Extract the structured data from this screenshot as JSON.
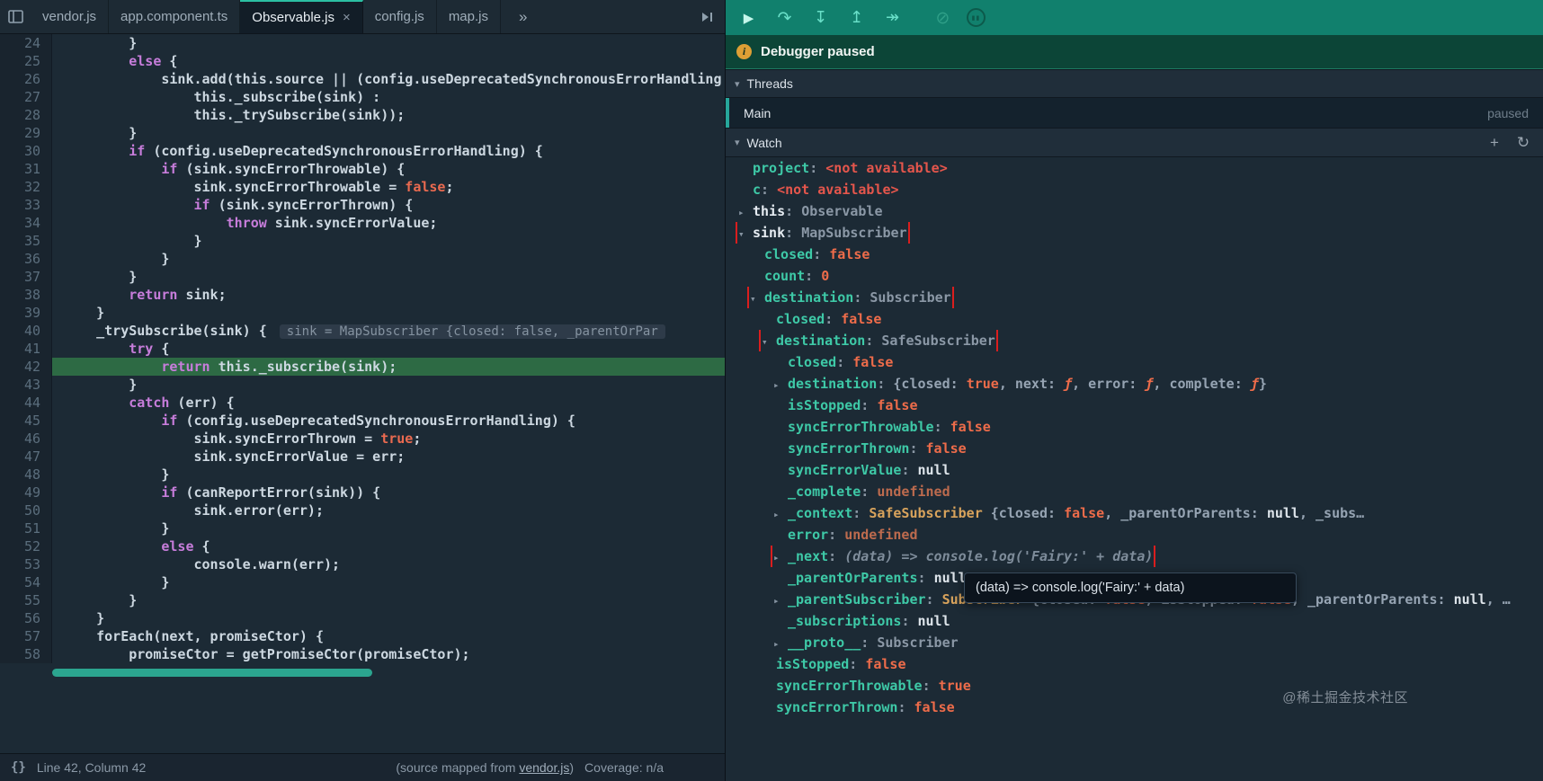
{
  "tabbar": {
    "tabs": [
      {
        "label": "vendor.js",
        "active": false
      },
      {
        "label": "app.component.ts",
        "active": false
      },
      {
        "label": "Observable.js",
        "active": true,
        "close_label": "×"
      },
      {
        "label": "config.js",
        "active": false
      },
      {
        "label": "map.js",
        "active": false
      }
    ],
    "overflow_label": "»"
  },
  "editor": {
    "current_line": 42,
    "inline_preview": {
      "line": 40,
      "text": "sink = MapSubscriber {closed: false, _parentOrPar"
    },
    "lines": [
      {
        "n": 24,
        "t": "        }"
      },
      {
        "n": 25,
        "t": "        else {"
      },
      {
        "n": 26,
        "t": "            sink.add(this.source || (config.useDeprecatedSynchronousErrorHandling ?"
      },
      {
        "n": 27,
        "t": "                this._subscribe(sink) :"
      },
      {
        "n": 28,
        "t": "                this._trySubscribe(sink));"
      },
      {
        "n": 29,
        "t": "        }"
      },
      {
        "n": 30,
        "t": "        if (config.useDeprecatedSynchronousErrorHandling) {"
      },
      {
        "n": 31,
        "t": "            if (sink.syncErrorThrowable) {"
      },
      {
        "n": 32,
        "t": "                sink.syncErrorThrowable = false;"
      },
      {
        "n": 33,
        "t": "                if (sink.syncErrorThrown) {"
      },
      {
        "n": 34,
        "t": "                    throw sink.syncErrorValue;"
      },
      {
        "n": 35,
        "t": "                }"
      },
      {
        "n": 36,
        "t": "            }"
      },
      {
        "n": 37,
        "t": "        }"
      },
      {
        "n": 38,
        "t": "        return sink;"
      },
      {
        "n": 39,
        "t": "    }"
      },
      {
        "n": 40,
        "t": "    _trySubscribe(sink) {"
      },
      {
        "n": 41,
        "t": "        try {"
      },
      {
        "n": 42,
        "t": "            return this._subscribe(sink);"
      },
      {
        "n": 43,
        "t": "        }"
      },
      {
        "n": 44,
        "t": "        catch (err) {"
      },
      {
        "n": 45,
        "t": "            if (config.useDeprecatedSynchronousErrorHandling) {"
      },
      {
        "n": 46,
        "t": "                sink.syncErrorThrown = true;"
      },
      {
        "n": 47,
        "t": "                sink.syncErrorValue = err;"
      },
      {
        "n": 48,
        "t": "            }"
      },
      {
        "n": 49,
        "t": "            if (canReportError(sink)) {"
      },
      {
        "n": 50,
        "t": "                sink.error(err);"
      },
      {
        "n": 51,
        "t": "            }"
      },
      {
        "n": 52,
        "t": "            else {"
      },
      {
        "n": 53,
        "t": "                console.warn(err);"
      },
      {
        "n": 54,
        "t": "            }"
      },
      {
        "n": 55,
        "t": "        }"
      },
      {
        "n": 56,
        "t": "    }"
      },
      {
        "n": 57,
        "t": "    forEach(next, promiseCtor) {"
      },
      {
        "n": 58,
        "t": "        promiseCtor = getPromiseCtor(promiseCtor);"
      }
    ]
  },
  "statusbar": {
    "brackets_icon": "{}",
    "cursor_position": "Line 42, Column 42",
    "source_map_prefix": "(source mapped from ",
    "source_map_link": "vendor.js",
    "source_map_suffix": ")",
    "coverage": "Coverage: n/a"
  },
  "debugger_panel": {
    "toolbar_icons": [
      {
        "name": "resume",
        "glyph": "▶"
      },
      {
        "name": "step-over",
        "glyph": "↷"
      },
      {
        "name": "step-in",
        "glyph": "↧"
      },
      {
        "name": "step-out",
        "glyph": "↥"
      },
      {
        "name": "step-forward",
        "glyph": "↠"
      },
      {
        "name": "deactivate-breakpoints",
        "glyph": "⊘"
      },
      {
        "name": "pause-on-exceptions",
        "glyph": "▮▮"
      }
    ],
    "paused_banner": {
      "text": "Debugger paused"
    },
    "threads": {
      "title": "Threads",
      "items": [
        {
          "name": "Main",
          "state": "paused"
        }
      ]
    },
    "watch": {
      "title": "Watch",
      "add_icon": "+",
      "refresh_icon": "↻",
      "rows": [
        {
          "indent": 0,
          "arrow": "none",
          "name": "project",
          "name_style": "green",
          "boxed": false,
          "value": [
            {
              "s": "err",
              "t": "<not available>"
            }
          ]
        },
        {
          "indent": 0,
          "arrow": "none",
          "name": "c",
          "name_style": "green",
          "boxed": false,
          "value": [
            {
              "s": "err",
              "t": "<not available>"
            }
          ]
        },
        {
          "indent": 0,
          "arrow": "collapsed",
          "name": "this",
          "name_style": "light",
          "boxed": false,
          "value": [
            {
              "s": "cls",
              "t": "Observable"
            }
          ]
        },
        {
          "indent": 0,
          "arrow": "expanded",
          "name": "sink",
          "name_style": "light",
          "boxed": true,
          "value": [
            {
              "s": "cls",
              "t": "MapSubscriber"
            }
          ]
        },
        {
          "indent": 1,
          "arrow": "none",
          "name": "closed",
          "name_style": "green",
          "boxed": false,
          "value": [
            {
              "s": "bool",
              "t": "false"
            }
          ]
        },
        {
          "indent": 1,
          "arrow": "none",
          "name": "count",
          "name_style": "green",
          "boxed": false,
          "value": [
            {
              "s": "num",
              "t": "0"
            }
          ]
        },
        {
          "indent": 1,
          "arrow": "expanded",
          "name": "destination",
          "name_style": "green",
          "boxed": true,
          "value": [
            {
              "s": "cls",
              "t": "Subscriber"
            }
          ]
        },
        {
          "indent": 2,
          "arrow": "none",
          "name": "closed",
          "name_style": "green",
          "boxed": false,
          "value": [
            {
              "s": "bool",
              "t": "false"
            }
          ]
        },
        {
          "indent": 2,
          "arrow": "expanded",
          "name": "destination",
          "name_style": "green",
          "boxed": true,
          "value": [
            {
              "s": "cls",
              "t": "SafeSubscriber"
            }
          ]
        },
        {
          "indent": 3,
          "arrow": "none",
          "name": "closed",
          "name_style": "green",
          "boxed": false,
          "value": [
            {
              "s": "bool",
              "t": "false"
            }
          ]
        },
        {
          "indent": 3,
          "arrow": "collapsed",
          "name": "destination",
          "name_style": "green",
          "boxed": false,
          "value": [
            {
              "s": "obj",
              "t": "{closed: "
            },
            {
              "s": "bool",
              "t": "true"
            },
            {
              "s": "obj",
              "t": ", next: "
            },
            {
              "s": "fn",
              "t": "ƒ"
            },
            {
              "s": "obj",
              "t": ", error: "
            },
            {
              "s": "fn",
              "t": "ƒ"
            },
            {
              "s": "obj",
              "t": ", complete: "
            },
            {
              "s": "fn",
              "t": "ƒ"
            },
            {
              "s": "obj",
              "t": "}"
            }
          ]
        },
        {
          "indent": 3,
          "arrow": "none",
          "name": "isStopped",
          "name_style": "green",
          "boxed": false,
          "value": [
            {
              "s": "bool",
              "t": "false"
            }
          ]
        },
        {
          "indent": 3,
          "arrow": "none",
          "name": "syncErrorThrowable",
          "name_style": "green",
          "boxed": false,
          "value": [
            {
              "s": "bool",
              "t": "false"
            }
          ]
        },
        {
          "indent": 3,
          "arrow": "none",
          "name": "syncErrorThrown",
          "name_style": "green",
          "boxed": false,
          "value": [
            {
              "s": "bool",
              "t": "false"
            }
          ]
        },
        {
          "indent": 3,
          "arrow": "none",
          "name": "syncErrorValue",
          "name_style": "green",
          "boxed": false,
          "value": [
            {
              "s": "null",
              "t": "null"
            }
          ]
        },
        {
          "indent": 3,
          "arrow": "none",
          "name": "_complete",
          "name_style": "green",
          "boxed": false,
          "value": [
            {
              "s": "undef",
              "t": "undefined"
            }
          ]
        },
        {
          "indent": 3,
          "arrow": "collapsed",
          "name": "_context",
          "name_style": "green",
          "boxed": false,
          "value": [
            {
              "s": "clsem",
              "t": "SafeSubscriber "
            },
            {
              "s": "obj",
              "t": "{closed: "
            },
            {
              "s": "bool",
              "t": "false"
            },
            {
              "s": "obj",
              "t": ", _parentOrParents: "
            },
            {
              "s": "null",
              "t": "null"
            },
            {
              "s": "obj",
              "t": ", _subs…"
            }
          ]
        },
        {
          "indent": 3,
          "arrow": "none",
          "name": "error",
          "name_style": "green",
          "boxed": false,
          "value": [
            {
              "s": "undef",
              "t": "undefined"
            }
          ]
        },
        {
          "indent": 3,
          "arrow": "collapsed",
          "name": "_next",
          "name_style": "green",
          "boxed": true,
          "value": [
            {
              "s": "afn",
              "t": "(data) => console.log('Fairy:' + data)"
            }
          ]
        },
        {
          "indent": 3,
          "arrow": "none",
          "name": "_parentOrParents",
          "name_style": "green",
          "boxed": false,
          "value": [
            {
              "s": "null",
              "t": "null"
            }
          ]
        },
        {
          "indent": 3,
          "arrow": "collapsed",
          "name": "_parentSubscriber",
          "name_style": "green",
          "boxed": false,
          "value": [
            {
              "s": "clsem",
              "t": "Subscriber "
            },
            {
              "s": "obj",
              "t": "{closed: "
            },
            {
              "s": "bool",
              "t": "false"
            },
            {
              "s": "obj",
              "t": ", isStopped: "
            },
            {
              "s": "bool",
              "t": "false"
            },
            {
              "s": "obj",
              "t": ", _parentOrParents: "
            },
            {
              "s": "null",
              "t": "null"
            },
            {
              "s": "obj",
              "t": ", …"
            }
          ]
        },
        {
          "indent": 3,
          "arrow": "none",
          "name": "_subscriptions",
          "name_style": "green",
          "boxed": false,
          "value": [
            {
              "s": "null",
              "t": "null"
            }
          ]
        },
        {
          "indent": 3,
          "arrow": "collapsed",
          "name": "__proto__",
          "name_style": "green",
          "boxed": false,
          "value": [
            {
              "s": "cls",
              "t": "Subscriber"
            }
          ]
        },
        {
          "indent": 2,
          "arrow": "none",
          "name": "isStopped",
          "name_style": "green",
          "boxed": false,
          "value": [
            {
              "s": "bool",
              "t": "false"
            }
          ]
        },
        {
          "indent": 2,
          "arrow": "none",
          "name": "syncErrorThrowable",
          "name_style": "green",
          "boxed": false,
          "value": [
            {
              "s": "bool",
              "t": "true"
            }
          ]
        },
        {
          "indent": 2,
          "arrow": "none",
          "name": "syncErrorThrown",
          "name_style": "green",
          "boxed": false,
          "value": [
            {
              "s": "bool",
              "t": "false"
            }
          ]
        }
      ]
    }
  },
  "tooltip": {
    "text": "(data) => console.log('Fairy:' + data)"
  },
  "watermark": "@稀土掘金技术社区",
  "accent_colors": {
    "teal": "#26a69a",
    "highlight_line_green": "#2d6a44",
    "annotation_red": "#da1e1e",
    "toolbar_teal": "#11806d"
  }
}
